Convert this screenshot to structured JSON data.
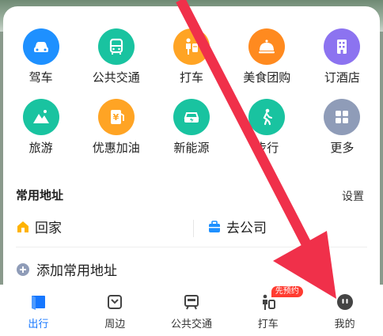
{
  "services": [
    {
      "label": "驾车",
      "icon": "car-icon",
      "color": "#1e90ff"
    },
    {
      "label": "公共交通",
      "icon": "bus-icon",
      "color": "#19c3a0"
    },
    {
      "label": "打车",
      "icon": "taxi-icon",
      "color": "#ffa424"
    },
    {
      "label": "美食团购",
      "icon": "food-cloche-icon",
      "color": "#ff8a1f"
    },
    {
      "label": "订酒店",
      "icon": "hotel-icon",
      "color": "#8c73f0"
    },
    {
      "label": "旅游",
      "icon": "mountain-icon",
      "color": "#19c3a0"
    },
    {
      "label": "优惠加油",
      "icon": "fuel-coupon-icon",
      "color": "#ffa424"
    },
    {
      "label": "新能源",
      "icon": "ev-charging-icon",
      "color": "#19c3a0"
    },
    {
      "label": "步行",
      "icon": "walking-icon",
      "color": "#19c3a0"
    },
    {
      "label": "更多",
      "icon": "grid-more-icon",
      "color": "#8f9cb8"
    }
  ],
  "common_address": {
    "title": "常用地址",
    "settings": "设置",
    "home": "回家",
    "company": "去公司",
    "add": "添加常用地址"
  },
  "tabs": [
    {
      "label": "出行",
      "icon": "travel-tab-icon",
      "active": true
    },
    {
      "label": "周边",
      "icon": "nearby-tab-icon",
      "active": false
    },
    {
      "label": "公共交通",
      "icon": "transit-tab-icon",
      "active": false
    },
    {
      "label": "打车",
      "icon": "taxi-tab-icon",
      "active": false,
      "badge": "先预约"
    },
    {
      "label": "我的",
      "icon": "profile-tab-icon",
      "active": false
    }
  ],
  "colors": {
    "accent": "#1677ff",
    "home_icon": "#ffb300",
    "company_icon": "#1e90ff",
    "badge": "#ff3b30",
    "annotation_arrow": "#f0304a"
  }
}
